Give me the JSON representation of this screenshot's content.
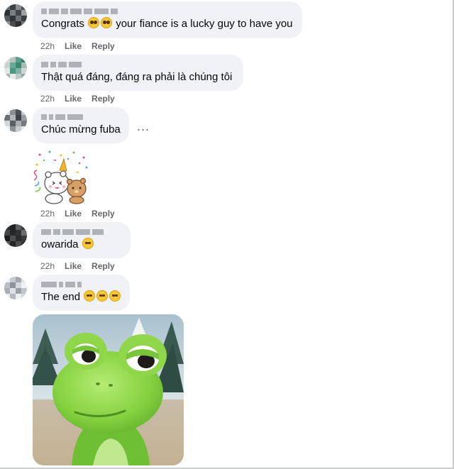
{
  "comments": [
    {
      "text": "Congrats",
      "text_after": "your fiance is a lucky guy to have you",
      "emojis": [
        "pleading-face-emoji",
        "pleading-face-emoji"
      ],
      "time": "22h",
      "like_label": "Like",
      "reply_label": "Reply"
    },
    {
      "text": "Thật quá đáng, đáng ra phải là chúng tôi",
      "time": "22h",
      "like_label": "Like",
      "reply_label": "Reply"
    },
    {
      "text": "Chúc mừng fuba",
      "more_label": "...",
      "sticker": "celebration-sticker",
      "time": "22h",
      "like_label": "Like",
      "reply_label": "Reply"
    },
    {
      "text": "owarida",
      "emojis": [
        "unamused-face-emoji"
      ],
      "time": "22h",
      "like_label": "Like",
      "reply_label": "Reply"
    },
    {
      "text": "The end",
      "emojis": [
        "expressionless-face-emoji",
        "expressionless-face-emoji",
        "expressionless-face-emoji"
      ],
      "gif": "green-frog-character-gif"
    }
  ],
  "colors": {
    "bubble": "#f0f2f5",
    "meta_text": "#65676b",
    "emoji_yellow": "#f7c634",
    "frog_green": "#7fce3b"
  }
}
